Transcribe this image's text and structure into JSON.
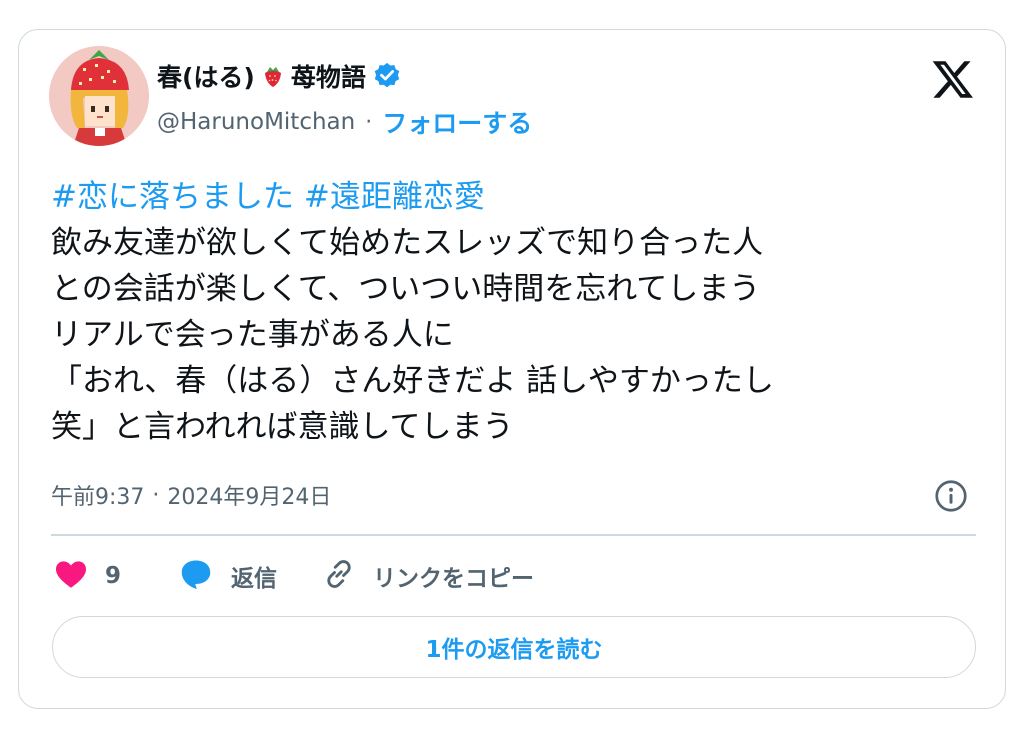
{
  "author": {
    "display_name": "春(はる)",
    "name_emoji": "strawberry-emoji",
    "name_suffix": "苺物語",
    "verified_icon": "verified-badge-icon",
    "handle": "@HarunoMitchan",
    "separator": "·",
    "follow_label": "フォローする"
  },
  "tweet": {
    "hashtags": [
      "#恋に落ちました",
      "#遠距離恋愛"
    ],
    "lines": [
      "飲み友達が欲しくて始めたスレッズで知り合った人",
      "との会話が楽しくて、ついつい時間を忘れてしまう",
      "リアルで会った事がある人に",
      "「おれ、春（はる）さん好きだよ 話しやすかったし",
      "笑」と言われれば意識してしまう"
    ]
  },
  "meta": {
    "time": "午前9:37",
    "separator": "·",
    "date": "2024年9月24日"
  },
  "actions": {
    "like_count": "9",
    "reply_label": "返信",
    "copy_link_label": "リンクをコピー"
  },
  "read_replies_label": "1件の返信を読む",
  "colors": {
    "accent": "#1d9bf0",
    "heart": "#f91880",
    "muted": "#536471",
    "border": "#cfd9de"
  },
  "icons": [
    "avatar",
    "strawberry-emoji",
    "verified-badge-icon",
    "x-logo-icon",
    "info-icon",
    "heart-icon",
    "reply-bubble-icon",
    "link-icon"
  ]
}
